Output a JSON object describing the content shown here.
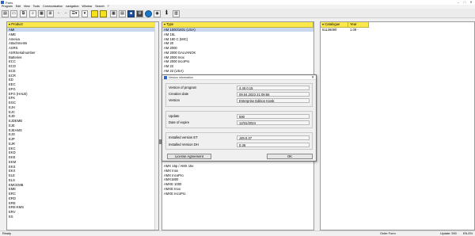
{
  "window": {
    "title": "Parts"
  },
  "menu": [
    "Program",
    "Edit",
    "View",
    "Tools",
    "Communication",
    "navigation",
    "Window",
    "Search",
    "?"
  ],
  "toolbar": {
    "info_glyph": "ℹ"
  },
  "product_panel": {
    "header": "Product",
    "items": [
      "AMI",
      "AME",
      "Ameiva",
      "Attachments",
      "ASRS",
      "ASRSerialnumber",
      "Batteries",
      "ECC",
      "ECD",
      "ECE",
      "ECR",
      "ED",
      "EEC",
      "EFG",
      "EFG (HALB)",
      "EFK",
      "EGC",
      "EJH",
      "EJC",
      "EJD",
      "EJDEMB",
      "EJE",
      "EJEAMS",
      "EJG",
      "EJP",
      "EJR",
      "EKC",
      "EKD",
      "EKE",
      "EKM",
      "EKS",
      "EKX",
      "ELE",
      "ELS",
      "EMCEMB",
      "EME",
      "ERC",
      "ERD",
      "ERE",
      "ERE-KMS",
      "ERV",
      "ES"
    ]
  },
  "type_panel": {
    "header": "Type",
    "items_top": [
      "AM 1000/1601 (USA)",
      "AM 15L",
      "AM 180 C (MIC)",
      "AM 20",
      "AM 2000",
      "AM 2000 GALVANOK",
      "AM 2000 Inox",
      "AM 2000 IncoPro",
      "AM 22",
      "AM 22 (USA)",
      "AM 2200"
    ],
    "items_bottom": [
      "AMX 15p / AMX 15x",
      "AMX Inox",
      "AMX IncoPro",
      "AMX1800",
      "AMXE 1000",
      "AMXE Inox",
      "AMXE IncoPro"
    ]
  },
  "catalogue_panel": {
    "headers": [
      "Catalogue",
      "Year"
    ],
    "rows": [
      [
        "51136090",
        "1.09 -"
      ]
    ]
  },
  "dialog": {
    "title": "Version information",
    "close_glyph": "✕",
    "version_of_program_label": "Version of program",
    "version_of_program": "4.40.0.15",
    "creation_date_label": "Creation date",
    "creation_date": "09.04.2023 21:09:56",
    "version_label": "Version",
    "version": "Enterprise Edition Kiosk",
    "update_label": "Update",
    "update": "590",
    "date_of_expire_label": "Date of expire",
    "date_of_expire": "12/31/2024",
    "installed_et_label": "Installed version ET",
    "installed_et": "J49.0.37",
    "installed_dh_label": "Installed Version DH",
    "installed_dh": "0.36",
    "license_button": "License Agreement",
    "ok_button": "OK"
  },
  "status": {
    "left": "Ready",
    "mid": "Order Form",
    "right1": "Update: 590",
    "right2": "EN-EN"
  }
}
